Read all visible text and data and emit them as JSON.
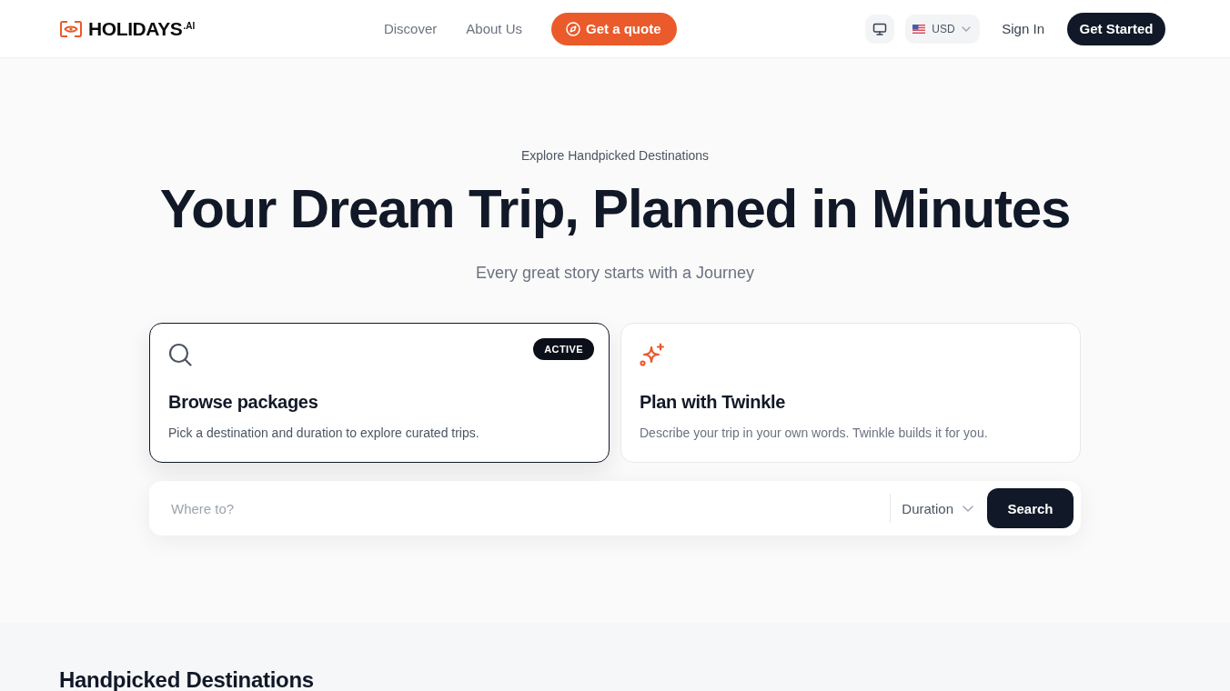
{
  "header": {
    "logo": "HOLIDAYS$^{.AI}$",
    "nav": [
      {
        "label": "Discover"
      },
      {
        "label": "About Us"
      }
    ],
    "quote_button": "Get a quote",
    "currency": "USD",
    "sign_in": "Sign In",
    "get_started": "Get Started"
  },
  "hero": {
    "eyebrow": "Explore Handpicked Destinations",
    "title": "Your Dream Trip, Planned in Minutes",
    "subtitle": "Every great story starts with a Journey",
    "modes": [
      {
        "kind": "search",
        "title": "Browse packages",
        "description": "Pick a destination and duration to explore curated trips.",
        "badge": "ACTIVE",
        "selected": true
      },
      {
        "kind": "sparkle",
        "title": "Plan with Twinkle",
        "description": "Describe your trip in your own words. Twinkle builds it for you.",
        "selected": false
      }
    ],
    "search": {
      "placeholder": "Where to?",
      "duration": "Duration",
      "button": "Search"
    }
  },
  "destinations": {
    "title": "Handpicked Destinations"
  }
}
